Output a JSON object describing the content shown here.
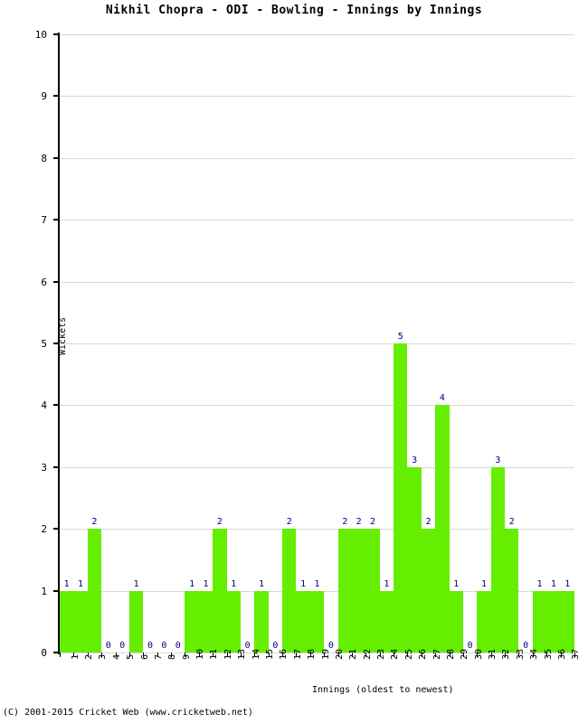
{
  "chart_data": {
    "type": "bar",
    "title": "Nikhil Chopra - ODI - Bowling - Innings by Innings",
    "xlabel": "Innings (oldest to newest)",
    "ylabel": "Wickets",
    "ylim": [
      0,
      10
    ],
    "ytick_step": 1,
    "grid": true,
    "legend": "none",
    "bar_color": "#66ee00",
    "label_color": "#000080",
    "show_value_labels": true,
    "categories": [
      "1",
      "2",
      "3",
      "4",
      "5",
      "6",
      "7",
      "8",
      "9",
      "10",
      "11",
      "12",
      "13",
      "14",
      "15",
      "16",
      "17",
      "18",
      "19",
      "20",
      "21",
      "22",
      "23",
      "24",
      "25",
      "26",
      "27",
      "28",
      "29",
      "30",
      "31",
      "32",
      "33",
      "34",
      "35",
      "36",
      "37"
    ],
    "values": [
      1,
      1,
      2,
      0,
      0,
      1,
      0,
      0,
      0,
      1,
      1,
      2,
      1,
      0,
      1,
      0,
      2,
      1,
      1,
      0,
      2,
      2,
      2,
      1,
      5,
      3,
      2,
      4,
      1,
      0,
      1,
      3,
      2,
      0,
      1,
      1,
      1
    ],
    "yticks": [
      "0",
      "1",
      "2",
      "3",
      "4",
      "5",
      "6",
      "7",
      "8",
      "9",
      "10"
    ]
  },
  "footer": {
    "copyright": "(C) 2001-2015 Cricket Web (www.cricketweb.net)"
  }
}
